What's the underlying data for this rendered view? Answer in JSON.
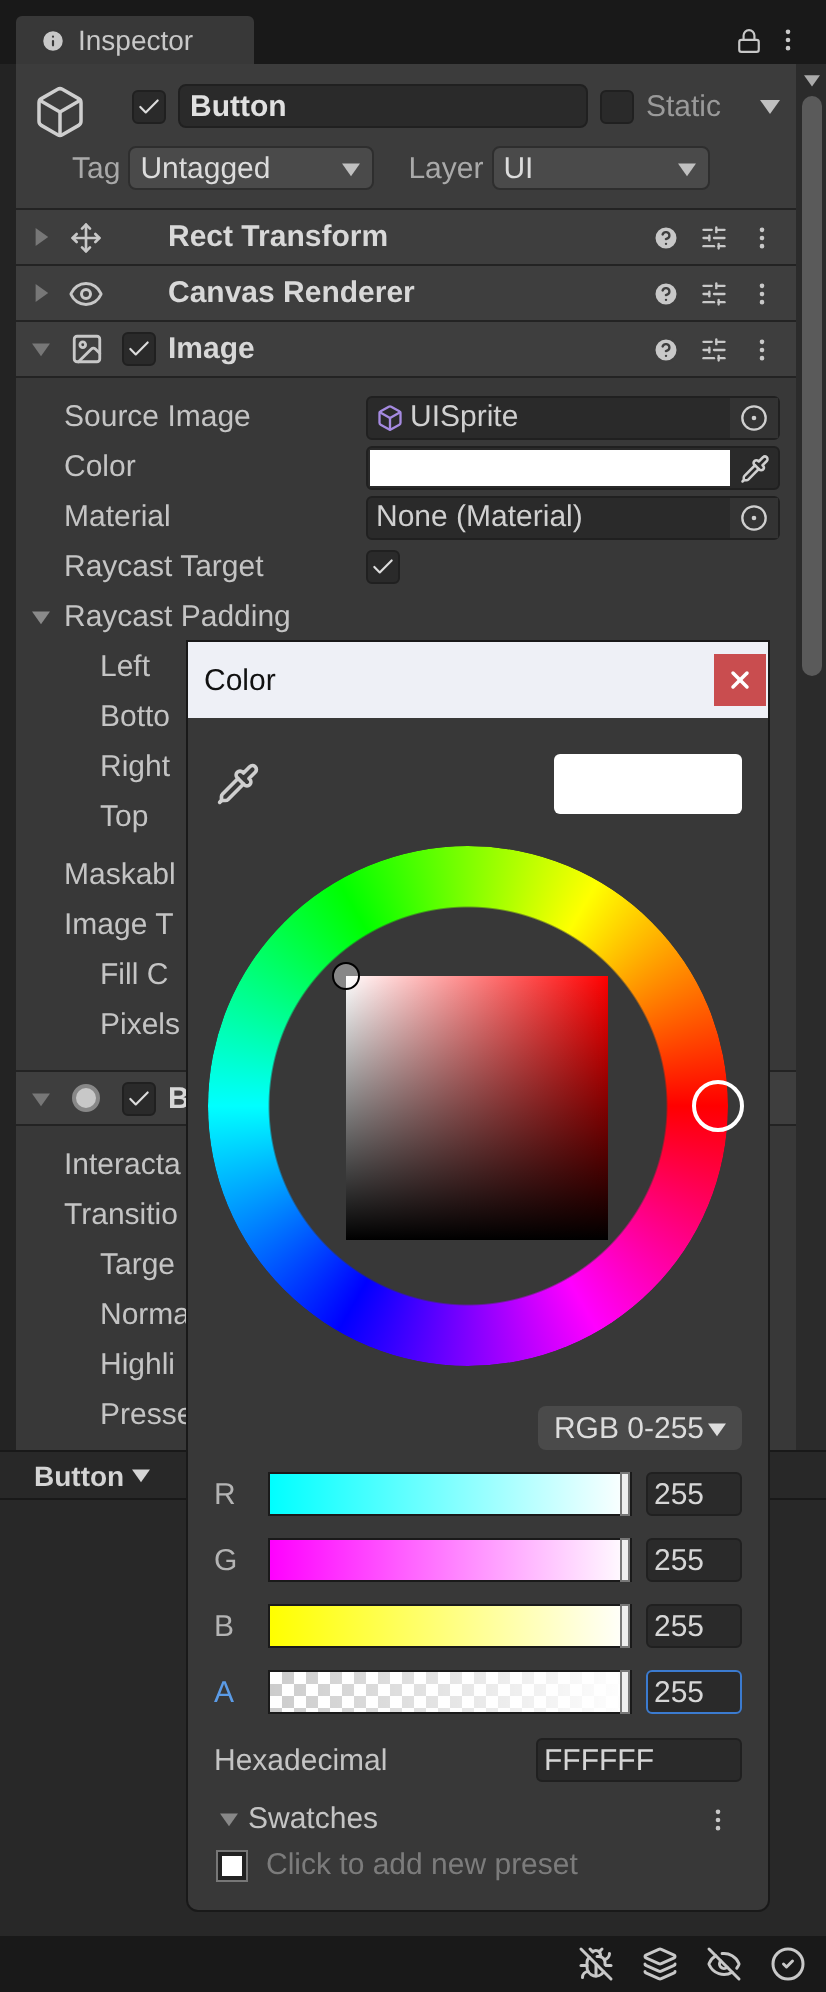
{
  "tab": {
    "title": "Inspector"
  },
  "object": {
    "active": true,
    "name": "Button",
    "static": false,
    "static_label": "Static",
    "tag_label": "Tag",
    "tag": "Untagged",
    "layer_label": "Layer",
    "layer": "UI"
  },
  "components": [
    {
      "kind": "rect",
      "title": "Rect Transform",
      "expanded": false
    },
    {
      "kind": "canvas",
      "title": "Canvas Renderer",
      "expanded": false
    },
    {
      "kind": "image",
      "title": "Image",
      "expanded": true,
      "enabled": true
    }
  ],
  "image_properties": [
    {
      "kind": "object",
      "label": "Source Image",
      "value": "UISprite"
    },
    {
      "kind": "color",
      "label": "Color",
      "color": "#ffffff"
    },
    {
      "kind": "object",
      "label": "Material",
      "value": "None (Material)"
    },
    {
      "kind": "check",
      "label": "Raycast Target",
      "checked": true
    },
    {
      "kind": "foldout",
      "label": "Raycast Padding",
      "expanded": true,
      "children": [
        {
          "kind": "plain",
          "label": "Left"
        },
        {
          "kind": "plain",
          "label": "Botto"
        },
        {
          "kind": "plain",
          "label": "Right"
        },
        {
          "kind": "plain",
          "label": "Top"
        }
      ]
    },
    {
      "kind": "plain",
      "label": "Maskabl"
    },
    {
      "kind": "plain",
      "label": "Image T",
      "children": [
        {
          "kind": "plain",
          "label": "Fill C"
        },
        {
          "kind": "plain",
          "label": "Pixels"
        }
      ]
    }
  ],
  "button_component": {
    "title": "B",
    "expanded": true,
    "enabled": true
  },
  "button_properties": [
    {
      "kind": "plain",
      "label": "Interacta"
    },
    {
      "kind": "plain",
      "label": "Transitio",
      "children": [
        {
          "kind": "plain",
          "label": "Targe"
        },
        {
          "kind": "plain",
          "label": "Norma"
        },
        {
          "kind": "plain",
          "label": "Highli"
        },
        {
          "kind": "plain",
          "label": "Presse"
        }
      ]
    }
  ],
  "lower_tab": {
    "label": "Button"
  },
  "color_picker": {
    "title": "Color",
    "mode": "RGB 0-255",
    "channels": [
      {
        "kind": "r",
        "label": "R",
        "value": "255",
        "level": 1,
        "selected": false
      },
      {
        "kind": "g",
        "label": "G",
        "value": "255",
        "level": 1,
        "selected": false
      },
      {
        "kind": "b",
        "label": "B",
        "value": "255",
        "level": 1,
        "selected": false
      },
      {
        "kind": "a",
        "label": "A",
        "value": "255",
        "level": 1,
        "selected": true
      }
    ],
    "hex_label": "Hexadecimal",
    "hex": "FFFFFF",
    "swatches_label": "Swatches",
    "swatches_expanded": true,
    "preset_hint": "Click to add new preset"
  }
}
